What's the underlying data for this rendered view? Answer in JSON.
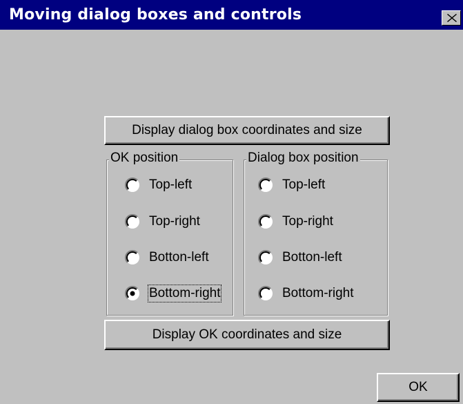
{
  "window": {
    "title": "Moving dialog boxes and controls"
  },
  "buttons": {
    "display_dialog_coords": "Display dialog box coordinates and size",
    "display_ok_coords": "Display OK coordinates and size",
    "ok": "OK"
  },
  "ok_position": {
    "label": "OK position",
    "options": [
      "Top-left",
      "Top-right",
      "Botton-left",
      "Bottom-right"
    ],
    "selected": "Bottom-right"
  },
  "dialog_position": {
    "label": "Dialog box position",
    "options": [
      "Top-left",
      "Top-right",
      "Botton-left",
      "Bottom-right"
    ],
    "selected": null
  }
}
